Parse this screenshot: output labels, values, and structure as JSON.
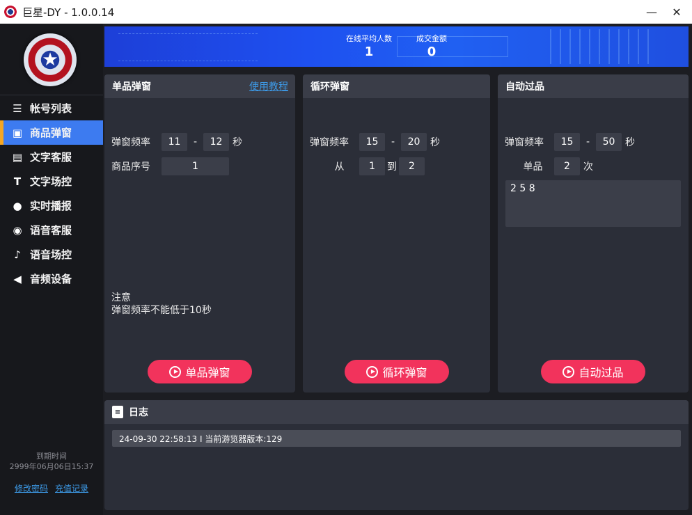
{
  "window": {
    "title": "巨星-DY - 1.0.0.14",
    "min_label": "—",
    "close_label": "✕"
  },
  "sidebar": {
    "logo_star": "★",
    "items": [
      {
        "label": "帐号列表",
        "icon": "list-icon",
        "glyph": "☰",
        "active": false
      },
      {
        "label": "商品弹窗",
        "icon": "shopping-bag-icon",
        "glyph": "▣",
        "active": true
      },
      {
        "label": "文字客服",
        "icon": "qa-chat-icon",
        "glyph": "▤",
        "active": false
      },
      {
        "label": "文字场控",
        "icon": "text-t-icon",
        "glyph": "T",
        "active": false
      },
      {
        "label": "实时播报",
        "icon": "wechat-bubbles-icon",
        "glyph": "●",
        "active": false
      },
      {
        "label": "语音客服",
        "icon": "headset-icon",
        "glyph": "◉",
        "active": false
      },
      {
        "label": "语音场控",
        "icon": "microphone-icon",
        "glyph": "♪",
        "active": false
      },
      {
        "label": "音频设备",
        "icon": "speaker-icon",
        "glyph": "◀",
        "active": false
      }
    ],
    "expire_label": "到期时间",
    "expire_value": "2999年06月06日15:37",
    "change_password": "修改密码",
    "recharge_record": "充值记录"
  },
  "banner": {
    "online_label": "在线平均人数",
    "online_value": "1",
    "sales_label": "成交金额",
    "sales_value": "0"
  },
  "single_panel": {
    "title": "单品弹窗",
    "help_link": "使用教程",
    "freq_label": "弹窗频率",
    "freq_min": "11",
    "freq_sep": "-",
    "freq_max": "12",
    "freq_unit": "秒",
    "index_label": "商品序号",
    "index_value": "1",
    "note_title": "注意",
    "note_text": "弹窗频率不能低于10秒",
    "button_label": "单品弹窗"
  },
  "loop_panel": {
    "title": "循环弹窗",
    "freq_label": "弹窗频率",
    "freq_min": "15",
    "freq_sep": "-",
    "freq_max": "20",
    "freq_unit": "秒",
    "from_label": "从",
    "from_value": "1",
    "to_label": "到",
    "to_value": "2",
    "button_label": "循环弹窗"
  },
  "auto_panel": {
    "title": "自动过品",
    "freq_label": "弹窗频率",
    "freq_min": "15",
    "freq_sep": "-",
    "freq_max": "50",
    "freq_unit": "秒",
    "single_label": "单品",
    "single_value": "2",
    "single_unit": "次",
    "items_text": "2 5 8",
    "button_label": "自动过品"
  },
  "log": {
    "title": "日志",
    "entries": [
      "24-09-30 22:58:13 I  当前游览器版本:129"
    ]
  },
  "colors": {
    "accent_blue": "#3d7bf0",
    "active_marker": "#f5a623",
    "action_button": "#f2335c",
    "link": "#3d9be9"
  }
}
